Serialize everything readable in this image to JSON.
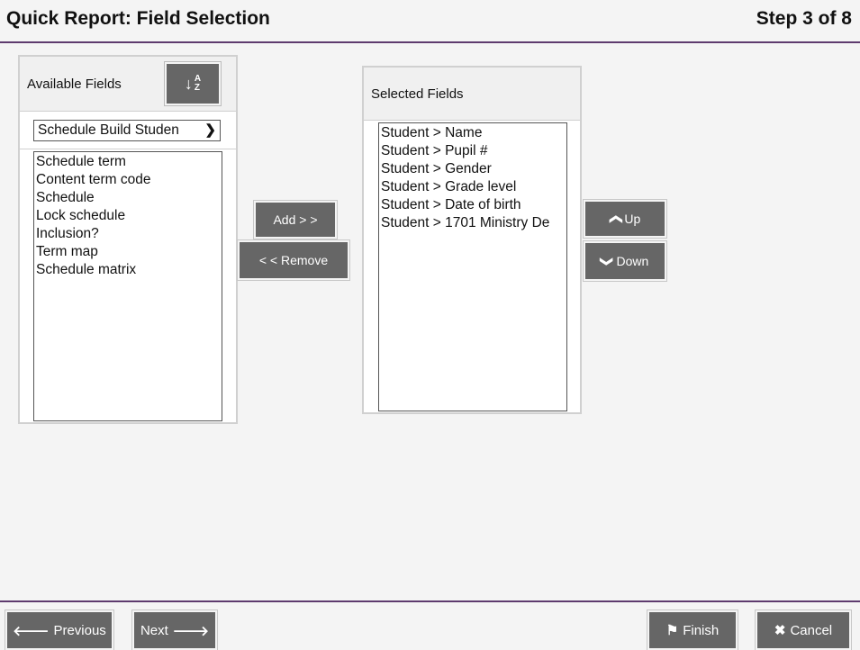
{
  "header": {
    "title": "Quick Report: Field Selection",
    "step": "Step 3 of 8"
  },
  "available": {
    "title": "Available Fields",
    "sort_icon": "sort-az-icon",
    "table_select": "Schedule Build Studen",
    "items": [
      "Schedule term",
      "Content term code",
      "Schedule",
      "Lock schedule",
      "Inclusion?",
      "Term map",
      "Schedule matrix"
    ]
  },
  "selected": {
    "title": "Selected Fields",
    "items": [
      "Student > Name",
      "Student > Pupil #",
      "Student > Gender",
      "Student > Grade level",
      "Student > Date of birth",
      "Student > 1701 Ministry De"
    ]
  },
  "actions": {
    "add": "Add > >",
    "remove": "< < Remove",
    "up": "Up",
    "down": "Down"
  },
  "footer": {
    "previous": "Previous",
    "next": "Next",
    "finish": "Finish",
    "cancel": "Cancel"
  },
  "colors": {
    "accent": "#5e3b6e",
    "button": "#666666"
  }
}
